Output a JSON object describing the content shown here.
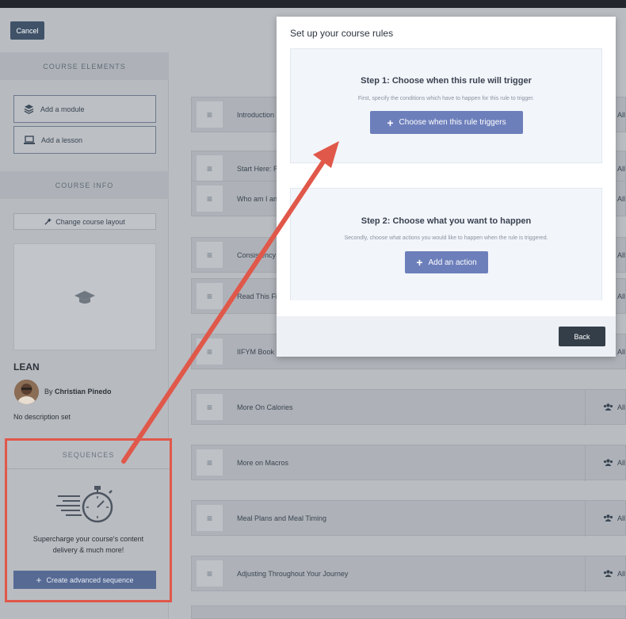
{
  "header": {
    "cancel_label": "Cancel"
  },
  "sidebar": {
    "course_elements_title": "COURSE ELEMENTS",
    "add_module_label": "Add a module",
    "add_lesson_label": "Add a lesson",
    "course_info_title": "COURSE INFO",
    "change_layout_label": "Change course layout",
    "course_name": "LEAN",
    "author_prefix": "By",
    "author_name": "Christian Pinedo",
    "description": "No description set",
    "sequences": {
      "title": "SEQUENCES",
      "text_line1": "Supercharge your course's content",
      "text_line2": "delivery & much more!",
      "button_label": "Create advanced sequence"
    }
  },
  "lessons": [
    {
      "title": "Introduction",
      "access": "All"
    },
    {
      "title": "Start Here: R",
      "access": "All"
    },
    {
      "title": "Who am I and",
      "access": "All"
    },
    {
      "title": "Consistency",
      "access": "All"
    },
    {
      "title": "Read This Fir",
      "access": "All"
    },
    {
      "title": "IIFYM Book D",
      "access": "All"
    },
    {
      "title": "More On Calories",
      "access": "All"
    },
    {
      "title": "More on Macros",
      "access": "All"
    },
    {
      "title": "Meal Plans and Meal Timing",
      "access": "All"
    },
    {
      "title": "Adjusting Throughout Your Journey",
      "access": "All"
    }
  ],
  "modal": {
    "title": "Set up your course rules",
    "step1": {
      "title": "Step 1: Choose when this rule will trigger",
      "subtitle": "First, specify the conditions which have to happen for this rule to trigger.",
      "button_label": "Choose when this rule triggers"
    },
    "step2": {
      "title": "Step 2: Choose what you want to happen",
      "subtitle": "Secondly, choose what actions you would like to happen when the rule is triggered.",
      "button_label": "Add an action"
    },
    "back_label": "Back"
  },
  "colors": {
    "primary_button": "#6d7fbb",
    "annotation": "#e0584a",
    "dark_button": "#343e48"
  }
}
